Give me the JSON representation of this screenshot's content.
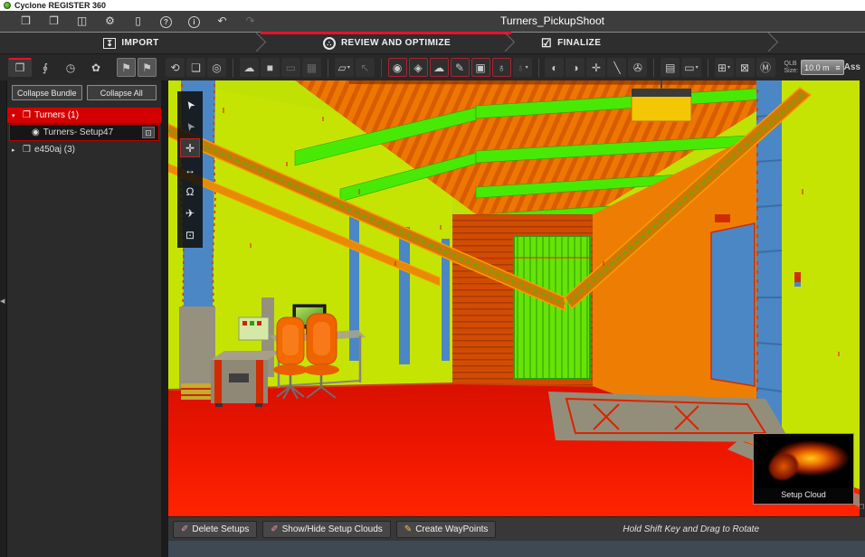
{
  "window_title": "Cyclone REGISTER 360",
  "project_title": "Turners_PickupShoot",
  "menu_icons": [
    {
      "name": "open-project",
      "glyph": "❒"
    },
    {
      "name": "save-project",
      "glyph": "❐"
    },
    {
      "name": "archive",
      "glyph": "◫"
    },
    {
      "name": "settings",
      "glyph": "⚙"
    },
    {
      "name": "storage",
      "glyph": "▯"
    },
    {
      "name": "help",
      "glyph": "?"
    },
    {
      "name": "info",
      "glyph": "i"
    },
    {
      "name": "undo",
      "glyph": "↶"
    },
    {
      "name": "redo",
      "glyph": "↷"
    }
  ],
  "workflow": {
    "import_label": "IMPORT",
    "import_icon": "↧",
    "review_label": "REVIEW AND OPTIMIZE",
    "review_icon": "∴",
    "finalize_label": "FINALIZE",
    "finalize_icon": "☑"
  },
  "toolbar": {
    "tabs": [
      {
        "name": "project-explorer-tab",
        "glyph": "❒"
      },
      {
        "name": "attachments-tab",
        "glyph": "∮"
      },
      {
        "name": "sites-tab",
        "glyph": "◷"
      },
      {
        "name": "bundle-settings-tab",
        "glyph": "✿"
      }
    ],
    "slicer": [
      {
        "glyph": "⚑"
      },
      {
        "glyph": "⚑"
      }
    ],
    "nav": [
      {
        "glyph": "⟲"
      },
      {
        "glyph": "❏"
      },
      {
        "glyph": "◎"
      }
    ],
    "views": [
      {
        "glyph": "☁"
      },
      {
        "glyph": "■"
      },
      {
        "glyph": "▭"
      },
      {
        "glyph": "▦"
      }
    ],
    "measure": [
      {
        "glyph": "▱"
      },
      {
        "glyph": "↖"
      }
    ],
    "annotate": [
      {
        "name": "add-target",
        "glyph": "◉"
      },
      {
        "name": "add-tag",
        "glyph": "◈"
      },
      {
        "name": "add-cloud",
        "glyph": "☁"
      },
      {
        "name": "add-sketch",
        "glyph": "✎"
      },
      {
        "name": "add-image",
        "glyph": "▣"
      },
      {
        "name": "add-geotag",
        "glyph": "♁"
      }
    ],
    "geo": [
      {
        "glyph": "♁"
      }
    ],
    "survey": [
      {
        "glyph": "◐"
      },
      {
        "glyph": "◑"
      },
      {
        "glyph": "✛"
      },
      {
        "glyph": "╲"
      },
      {
        "glyph": "✇"
      }
    ],
    "pano": [
      {
        "glyph": "▤"
      },
      {
        "glyph": "▭"
      }
    ],
    "cube": [
      {
        "glyph": "⊞"
      },
      {
        "glyph": "⊠"
      },
      {
        "glyph": "Ⓜ"
      }
    ],
    "qlb_label_1": "QLB",
    "qlb_label_2": "Size:",
    "qlb_value": "10.0 m",
    "menu_glyph": "≡",
    "caret": "▾",
    "assets_label": "Ass"
  },
  "sidebar": {
    "collapse_bundle": "Collapse Bundle",
    "collapse_all": "Collapse All",
    "tree": {
      "bundle1": {
        "arrow": "▾",
        "icon": "❒",
        "label": "Turners (1)"
      },
      "setup1": {
        "icon": "◉",
        "label": "Turners- Setup47",
        "badge": "⊡"
      },
      "bundle2": {
        "arrow": "▸",
        "icon": "❒",
        "label": "e450aj (3)"
      }
    }
  },
  "viewport": {
    "tools": [
      {
        "name": "select-tool",
        "glyph": "➤"
      },
      {
        "name": "multi-select-tool",
        "glyph": "➤"
      },
      {
        "name": "pan-tool",
        "glyph": "✛"
      },
      {
        "name": "measure-tool",
        "glyph": "↔"
      },
      {
        "name": "view-from-setup-tool",
        "glyph": "Ω"
      },
      {
        "name": "fly-tool",
        "glyph": "✈"
      },
      {
        "name": "cube-view-tool",
        "glyph": "⊡"
      }
    ],
    "thumbnail_label": "Setup Cloud",
    "hint": "Hold Shift Key and Drag to Rotate",
    "collapse_arrow": "◀",
    "expand_icon": "❐"
  },
  "footer": {
    "delete_setups": "Delete Setups",
    "show_hide": "Show/Hide Setup Clouds",
    "create_waypoints": "Create WayPoints",
    "button_icon": "✐",
    "pen_icon": "✎"
  },
  "colors": {
    "accent_red": "#e8112d",
    "selection_red": "#d40000"
  }
}
